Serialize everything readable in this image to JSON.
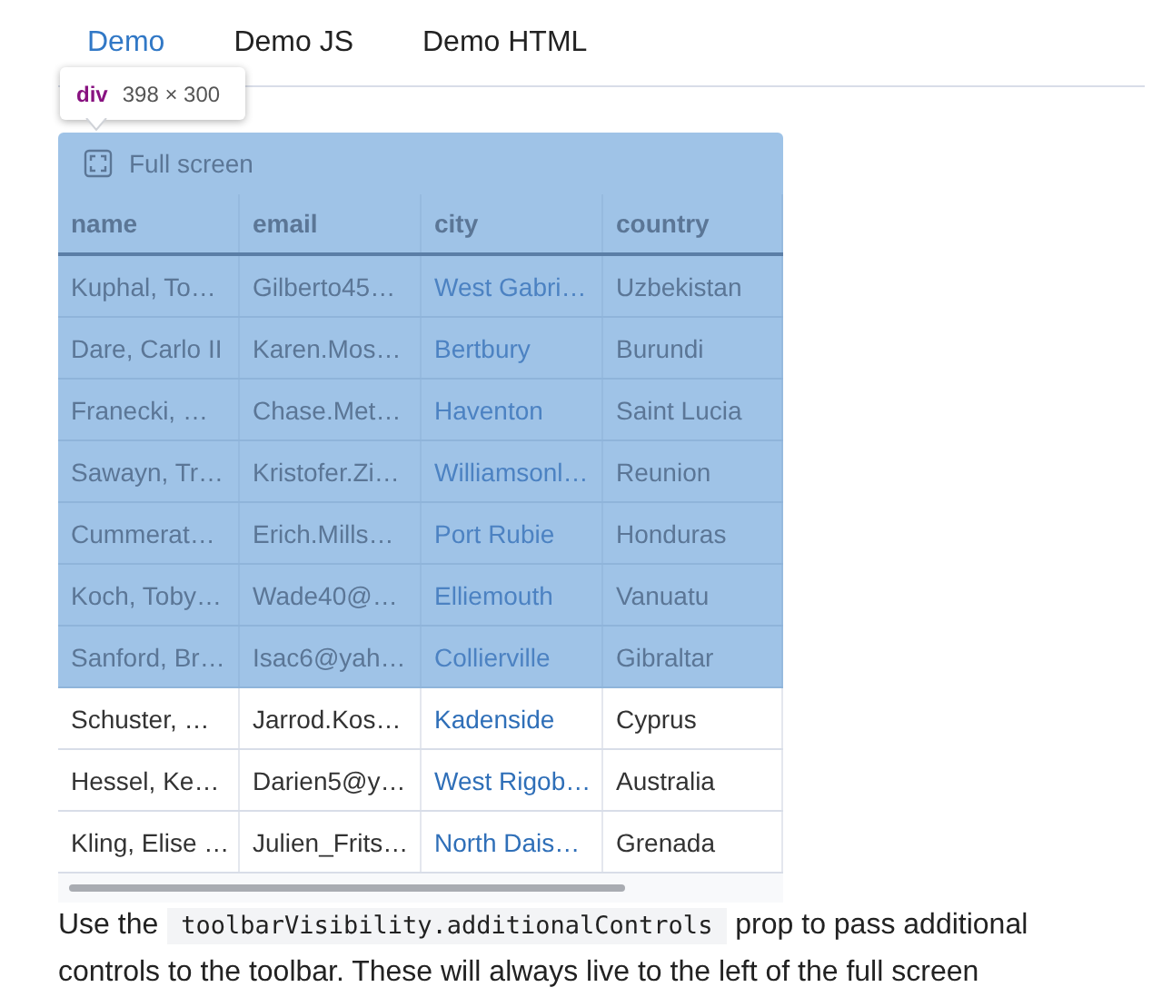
{
  "tabs": [
    {
      "label": "Demo",
      "selected": true
    },
    {
      "label": "Demo JS",
      "selected": false
    },
    {
      "label": "Demo HTML",
      "selected": false
    }
  ],
  "inspect_tooltip": {
    "tag": "div",
    "size": "398 × 300"
  },
  "toolbar": {
    "label": "Full screen",
    "highlighted": true
  },
  "table": {
    "header_highlighted": true,
    "columns": [
      "name",
      "email",
      "city",
      "country"
    ],
    "rows": [
      {
        "cells": [
          "Kuphal, To…",
          "Gilberto45…",
          "West Gabri…",
          "Uzbekistan"
        ],
        "highlighted": true
      },
      {
        "cells": [
          "Dare, Carlo II",
          "Karen.Mos…",
          "Bertbury",
          "Burundi"
        ],
        "highlighted": true
      },
      {
        "cells": [
          "Franecki, …",
          "Chase.Met…",
          "Haventon",
          "Saint Lucia"
        ],
        "highlighted": true
      },
      {
        "cells": [
          "Sawayn, Tr…",
          "Kristofer.Zi…",
          "Williamsonl…",
          "Reunion"
        ],
        "highlighted": true
      },
      {
        "cells": [
          "Cummerat…",
          "Erich.Mills…",
          "Port Rubie",
          "Honduras"
        ],
        "highlighted": true
      },
      {
        "cells": [
          "Koch, Toby…",
          "Wade40@…",
          "Elliemouth",
          "Vanuatu"
        ],
        "highlighted": true
      },
      {
        "cells": [
          "Sanford, Br…",
          "Isac6@yah…",
          "Collierville",
          "Gibraltar"
        ],
        "highlighted": true
      },
      {
        "cells": [
          "Schuster, …",
          "Jarrod.Kos…",
          "Kadenside",
          "Cyprus"
        ],
        "highlighted": false
      },
      {
        "cells": [
          "Hessel, Ke…",
          "Darien5@y…",
          "West Rigob…",
          "Australia"
        ],
        "highlighted": false
      },
      {
        "cells": [
          "Kling, Elise …",
          "Julien_Frits…",
          "North Dais…",
          "Grenada"
        ],
        "highlighted": false
      }
    ]
  },
  "paragraph": {
    "before": "Use the",
    "code": "toolbarVisibility.additionalControls",
    "after": "prop to pass additional controls to the toolbar. These will always live to the left of the full screen"
  }
}
